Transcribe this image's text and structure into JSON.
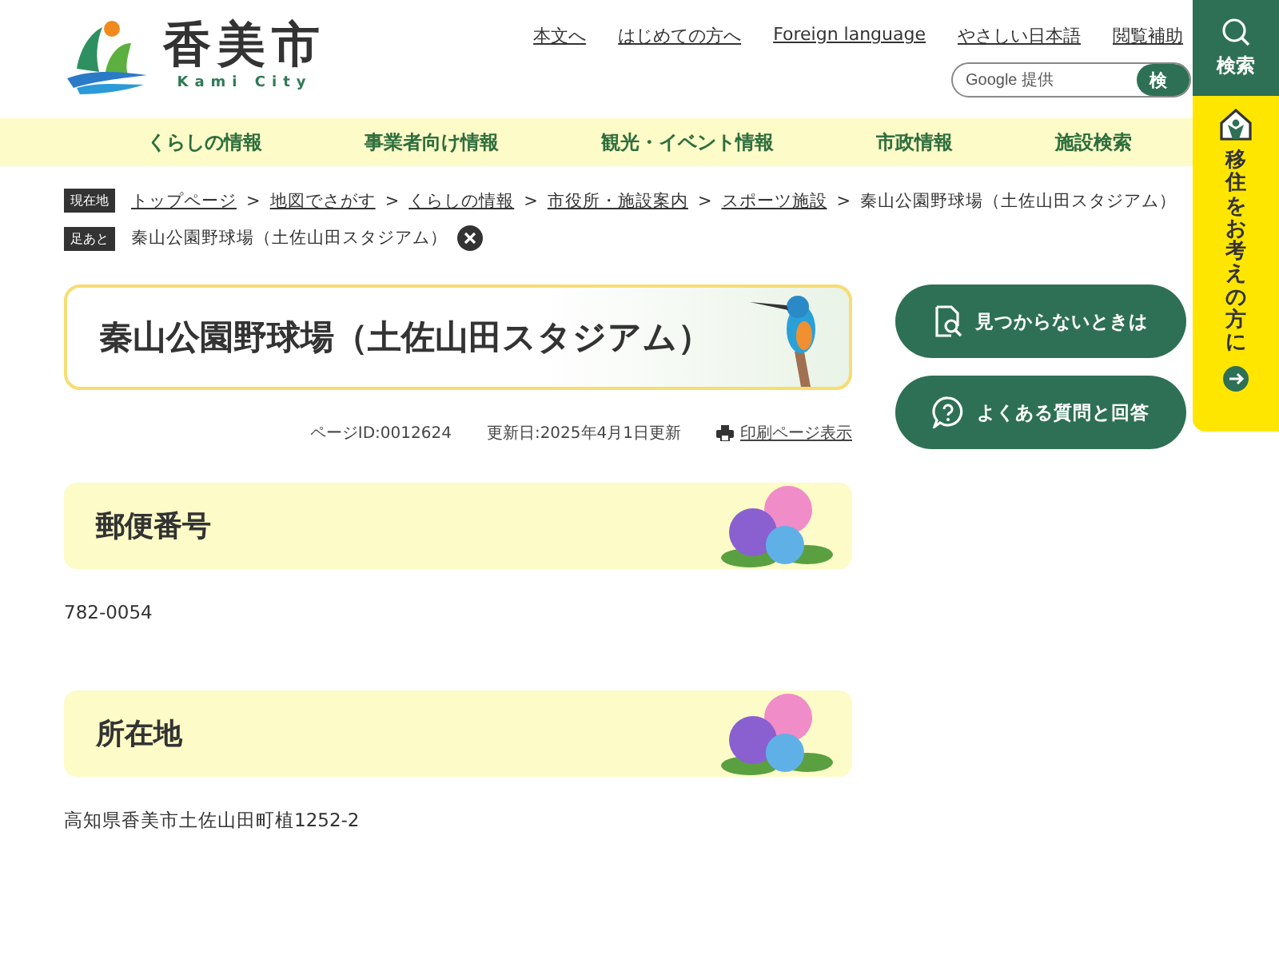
{
  "header": {
    "logo_title": "香美市",
    "logo_subtitle": "Kami City",
    "links": [
      "本文へ",
      "はじめての方へ",
      "Foreign language",
      "やさしい日本語",
      "閲覧補助"
    ],
    "search": {
      "placeholder": "Google 提供",
      "button": "検"
    }
  },
  "nav": [
    "くらしの情報",
    "事業者向け情報",
    "観光・イベント情報",
    "市政情報",
    "施設検索"
  ],
  "side": {
    "search": "検索",
    "migration": "移住をお考えの方に"
  },
  "breadcrumb": {
    "label": "現在地",
    "separator": ">",
    "items": [
      {
        "text": "トップページ",
        "link": true
      },
      {
        "text": "地図でさがす",
        "link": true
      },
      {
        "text": "くらしの情報",
        "link": true
      },
      {
        "text": "市役所・施設案内",
        "link": true
      },
      {
        "text": "スポーツ施設",
        "link": true
      },
      {
        "text": "秦山公園野球場（土佐山田スタジアム）",
        "link": false
      }
    ]
  },
  "footprints": {
    "label": "足あと",
    "items": [
      "秦山公園野球場（土佐山田スタジアム）"
    ]
  },
  "page": {
    "title": "秦山公園野球場（土佐山田スタジアム）",
    "page_id": "ページID:0012624",
    "updated": "更新日:2025年4月1日更新",
    "print": "印刷ページ表示"
  },
  "sections": [
    {
      "heading": "郵便番号",
      "body": "782-0054"
    },
    {
      "heading": "所在地",
      "body": "高知県香美市土佐山田町植1252-2"
    }
  ],
  "aside": [
    {
      "kind": "search",
      "label": "見つからないときは"
    },
    {
      "kind": "faq",
      "label": "よくある質問と回答"
    }
  ]
}
